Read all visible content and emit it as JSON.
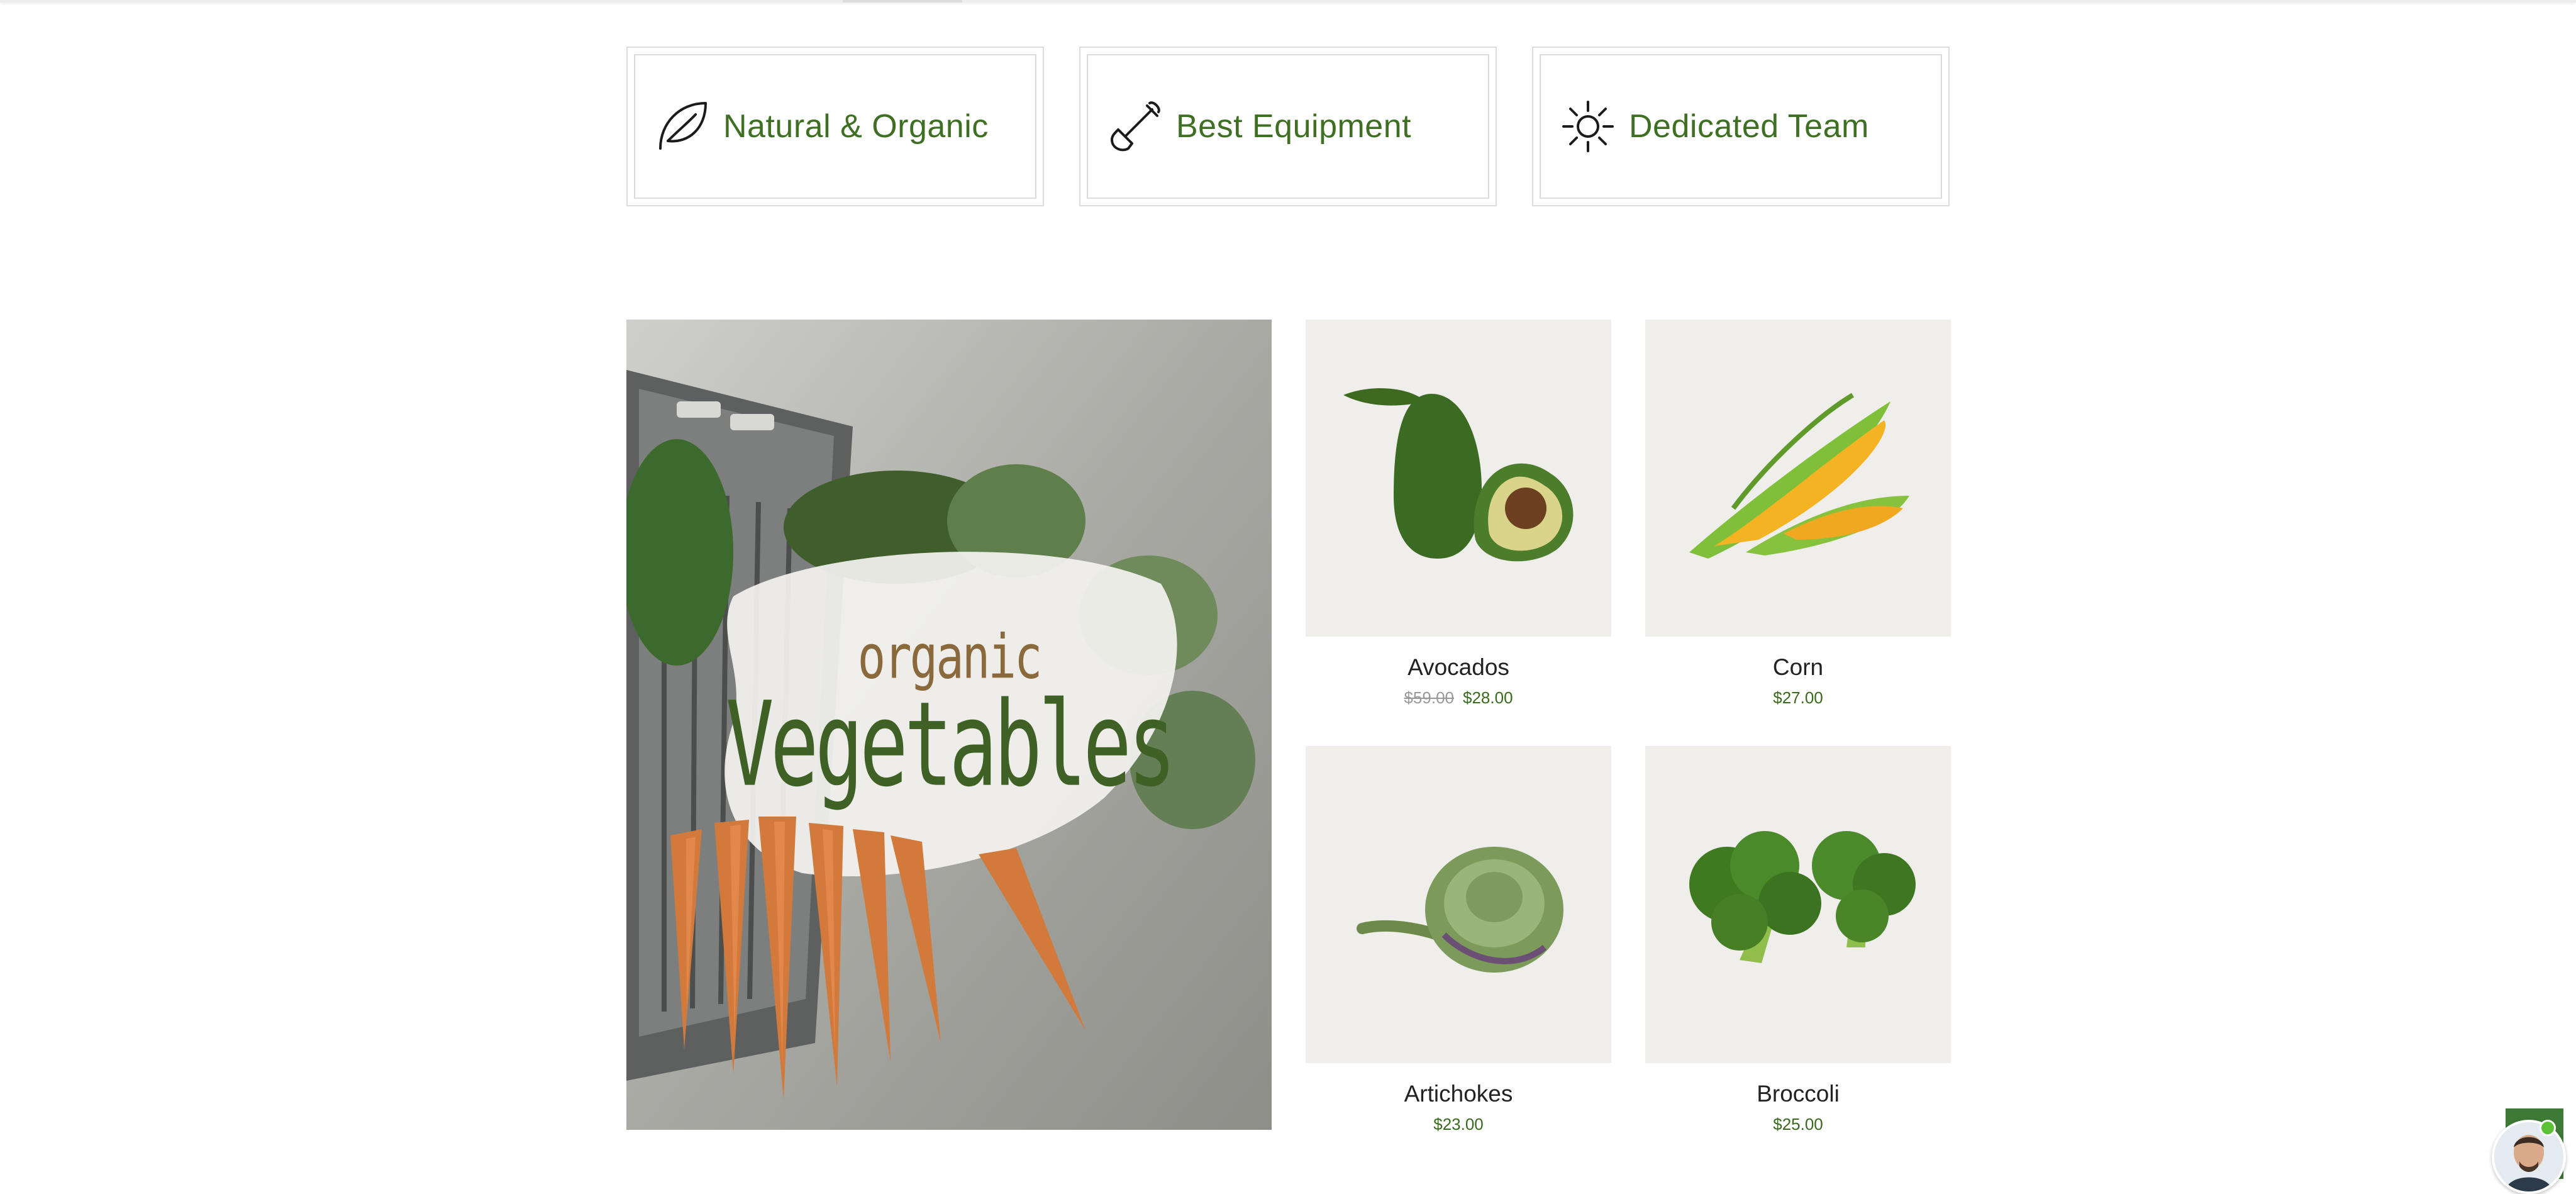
{
  "features": [
    {
      "title": "Natural & Organic",
      "icon": "leaf-icon"
    },
    {
      "title": "Best Equipment",
      "icon": "shovel-icon"
    },
    {
      "title": "Dedicated Team",
      "icon": "sun-icon"
    }
  ],
  "hero": {
    "small": "organic",
    "big": "Vegetables"
  },
  "products": [
    {
      "name": "Avocados",
      "old_price": "$59.00",
      "price": "$28.00"
    },
    {
      "name": "Corn",
      "price": "$27.00"
    },
    {
      "name": "Artichokes",
      "price": "$23.00"
    },
    {
      "name": "Broccoli",
      "price": "$25.00"
    }
  ],
  "colors": {
    "accent_green": "#3f6f23",
    "price_green": "#3a6a1e",
    "hero_brown": "#8a6a3c",
    "chat_green": "#3c7a35"
  }
}
